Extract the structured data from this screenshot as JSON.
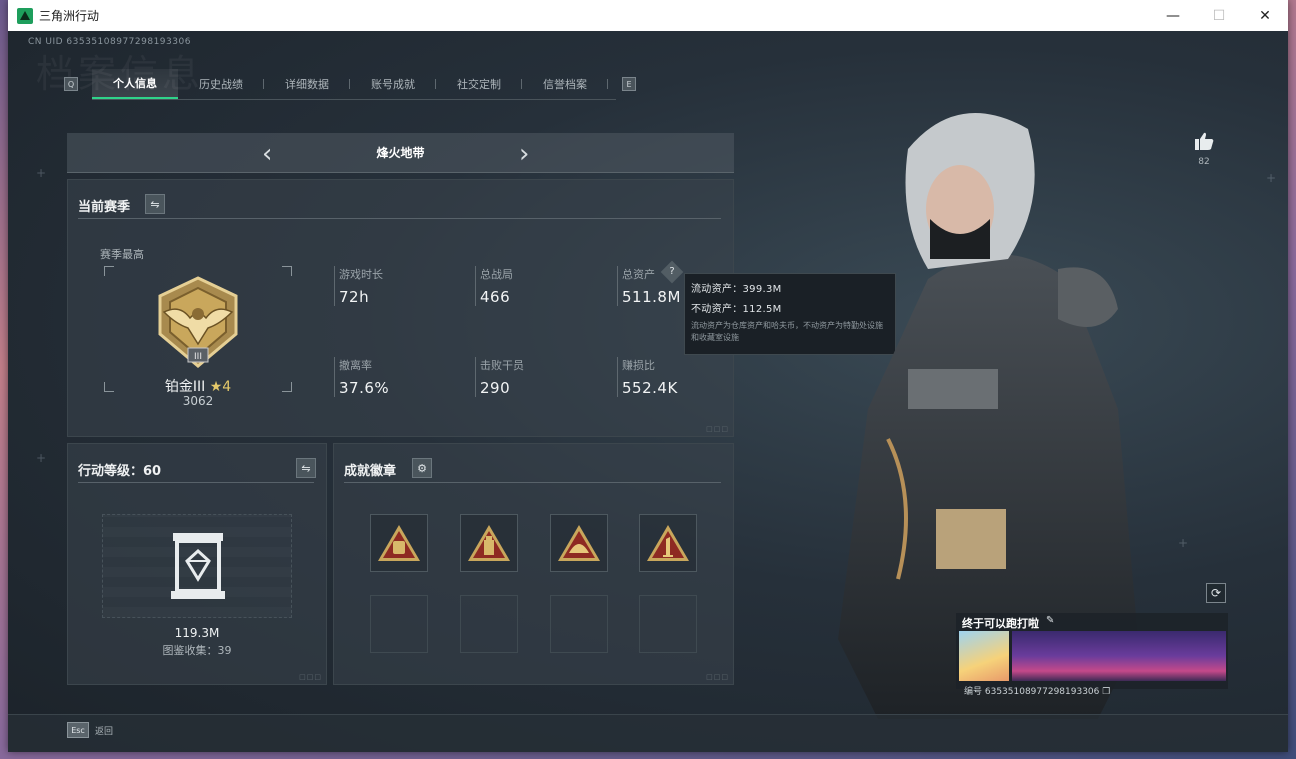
{
  "window": {
    "title": "三角洲行动",
    "controls": {
      "minimize": "—",
      "maximize": "☐",
      "close": "✕"
    }
  },
  "header": {
    "uid": "CN UID 63535108977298193306",
    "watermark": "档案信息"
  },
  "tabs": {
    "left_key": "Q",
    "right_key": "E",
    "items": [
      {
        "label": "个人信息",
        "active": true
      },
      {
        "label": "历史战绩",
        "active": false
      },
      {
        "label": "详细数据",
        "active": false
      },
      {
        "label": "账号成就",
        "active": false
      },
      {
        "label": "社交定制",
        "active": false
      },
      {
        "label": "信誉档案",
        "active": false
      }
    ]
  },
  "mode": {
    "title": "烽火地带",
    "prev": "‹",
    "next": "›"
  },
  "season": {
    "title": "当前赛季",
    "subtitle": "赛季最高",
    "rank_name": "铂金III",
    "rank_stars": "★4",
    "rank_score": "3062",
    "stats": [
      {
        "label": "游戏时长",
        "value": "72h"
      },
      {
        "label": "总战局",
        "value": "466"
      },
      {
        "label": "总资产",
        "value": "511.8M"
      },
      {
        "label": "撤离率",
        "value": "37.6%"
      },
      {
        "label": "击败干员",
        "value": "290"
      },
      {
        "label": "赚损比",
        "value": "552.4K"
      }
    ],
    "help_icon": "?"
  },
  "tooltip": {
    "liquid": "流动资产：399.3M",
    "fixed": "不动资产：112.5M",
    "note": "流动资产为仓库资产和哈夫币，不动资产为特勤处设施和收藏室设施"
  },
  "level": {
    "title": "行动等级：60",
    "value": "119.3M",
    "collection": "图鉴收集：39"
  },
  "badges": {
    "title": "成就徽章",
    "settings_icon": "⚙"
  },
  "profile": {
    "likes": "82",
    "name": "终于可以跑打啦",
    "edit_icon": "✎",
    "id": "编号 63535108977298193306",
    "refresh_icon": "⟳"
  },
  "footer": {
    "esc_key": "Esc",
    "esc_label": "返回"
  },
  "colors": {
    "accent": "#2fd38a",
    "gold": "#c9a75c",
    "badge_red": "#8e2a22"
  }
}
